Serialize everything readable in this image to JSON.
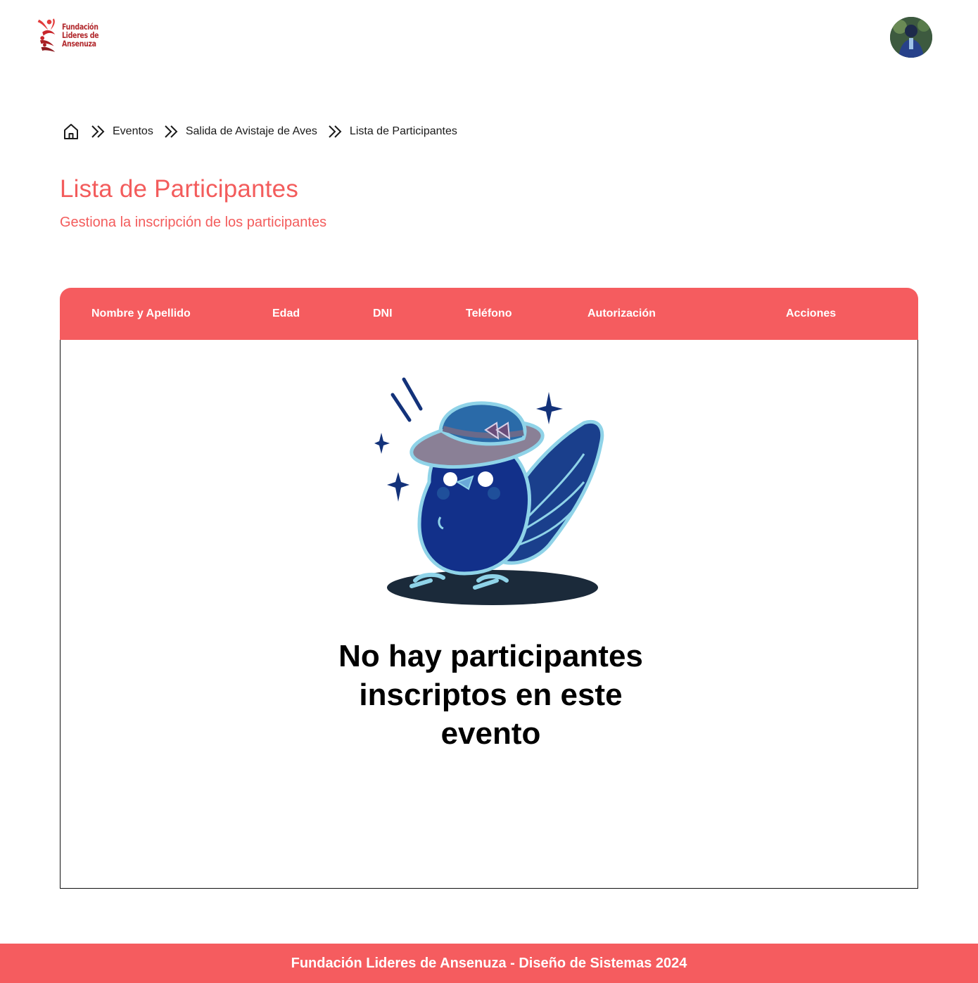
{
  "brand": {
    "logo_lines": [
      "Fundación",
      "Lideres de",
      "Ansenuza"
    ],
    "accent_color": "#f55c5f",
    "logo_color": "#b22a2e"
  },
  "header": {
    "avatar_icon": "user-avatar"
  },
  "breadcrumb": {
    "home_icon": "home-icon",
    "separator_icon": "double-chevron-right-icon",
    "items": [
      "Eventos",
      "Salida de Avistaje de Aves",
      "Lista de Participantes"
    ]
  },
  "page": {
    "title": "Lista de Participantes",
    "subtitle": "Gestiona la inscripción de los participantes"
  },
  "table": {
    "columns": [
      "Nombre y Apellido",
      "Edad",
      "DNI",
      "Teléfono",
      "Autorización",
      "Acciones"
    ],
    "rows": [],
    "empty_message": "No hay participantes inscriptos en este evento",
    "empty_illustration": "bird-with-hat-illustration"
  },
  "footer": {
    "text": "Fundación Lideres de Ansenuza - Diseño de Sistemas 2024"
  }
}
